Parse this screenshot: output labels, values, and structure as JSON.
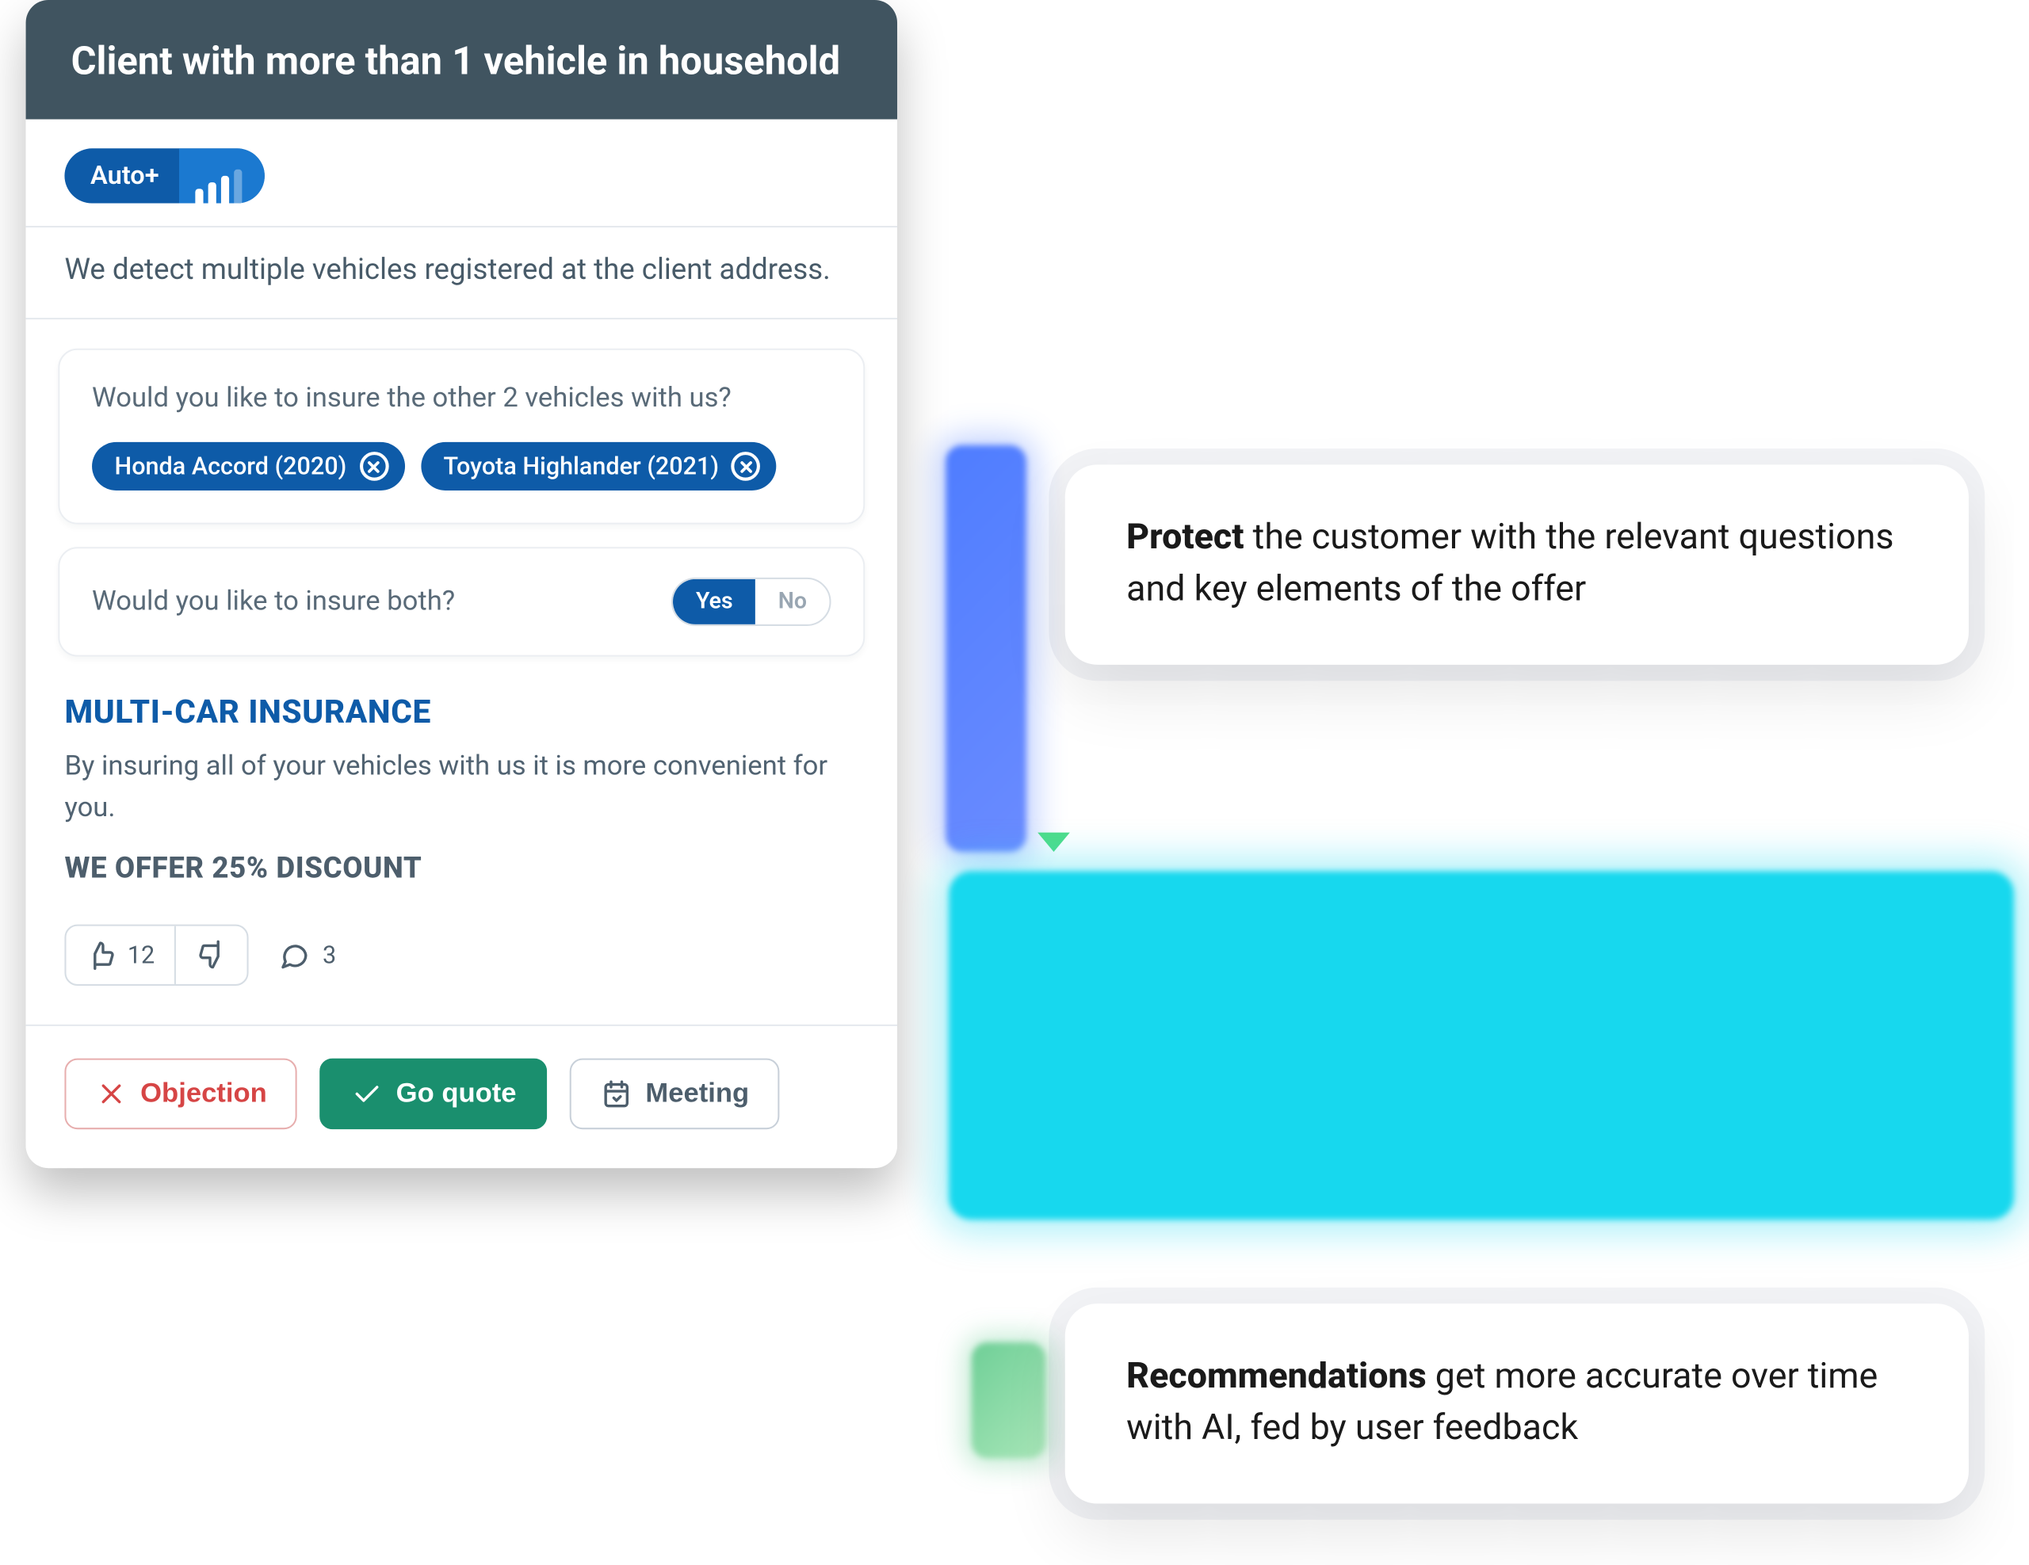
{
  "header": {
    "title": "Client with more than 1 vehicle in household"
  },
  "tag": {
    "label": "Auto+"
  },
  "detection": "We detect multiple vehicles registered at the client address.",
  "vehicles_question": "Would you like to insure the other 2 vehicles with us?",
  "vehicles": [
    {
      "label": "Honda Accord (2020)"
    },
    {
      "label": "Toyota Highlander (2021)"
    }
  ],
  "both_question": "Would you like to insure both?",
  "both_toggle": {
    "yes": "Yes",
    "no": "No",
    "value": "yes"
  },
  "offer": {
    "title": "MULTI-CAR INSURANCE",
    "body": "By insuring all of your vehicles with us it is more convenient for you.",
    "discount": "WE OFFER 25% DISCOUNT"
  },
  "feedback": {
    "likes": "12",
    "comments": "3"
  },
  "buttons": {
    "objection": "Objection",
    "quote": "Go quote",
    "meeting": "Meeting"
  },
  "callouts": {
    "protect_bold": "Protect",
    "protect_rest": " the customer with the relevant questions and key elements of the offer",
    "rec_bold": "Recommendations",
    "rec_rest": " get more accurate over time with AI, fed by user feedback"
  }
}
